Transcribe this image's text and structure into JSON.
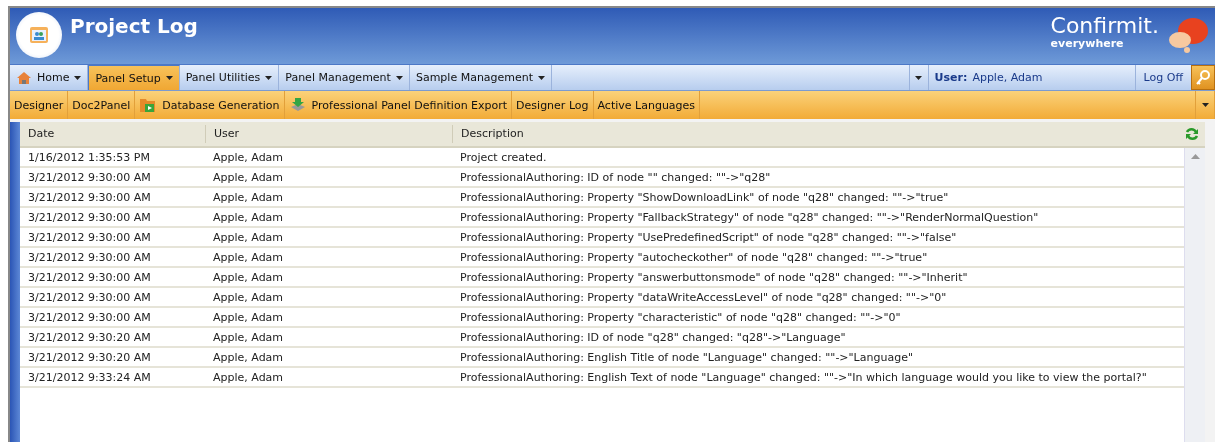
{
  "header": {
    "title": "Project Log",
    "brand": "Confirmit.",
    "tagline": "everywhere"
  },
  "menu": {
    "items": [
      {
        "label": "Home",
        "selected": false,
        "kind": "home"
      },
      {
        "label": "Panel Setup",
        "selected": true,
        "kind": "plain"
      },
      {
        "label": "Panel Utilities",
        "selected": false,
        "kind": "plain"
      },
      {
        "label": "Panel Management",
        "selected": false,
        "kind": "plain"
      },
      {
        "label": "Sample Management",
        "selected": false,
        "kind": "plain"
      }
    ],
    "user_label": "User:",
    "user_name": "Apple, Adam",
    "logoff": "Log Off"
  },
  "toolbar": {
    "items": [
      {
        "label": "Designer",
        "kind": "plain"
      },
      {
        "label": "Doc2Panel",
        "kind": "plain"
      },
      {
        "label": "Database Generation",
        "kind": "database"
      },
      {
        "label": "Professional Panel Definition Export",
        "kind": "export"
      },
      {
        "label": "Designer Log",
        "kind": "plain"
      },
      {
        "label": "Active Languages",
        "kind": "plain"
      }
    ]
  },
  "table": {
    "columns": [
      "Date",
      "User",
      "Description"
    ],
    "rows": [
      {
        "date": "1/16/2012 1:35:53 PM",
        "user": "Apple, Adam",
        "description": "Project created."
      },
      {
        "date": "3/21/2012 9:30:00 AM",
        "user": "Apple, Adam",
        "description": "ProfessionalAuthoring: ID of node \"\" changed: \"\"->\"q28\""
      },
      {
        "date": "3/21/2012 9:30:00 AM",
        "user": "Apple, Adam",
        "description": "ProfessionalAuthoring: Property \"ShowDownloadLink\" of node \"q28\" changed: \"\"->\"true\""
      },
      {
        "date": "3/21/2012 9:30:00 AM",
        "user": "Apple, Adam",
        "description": "ProfessionalAuthoring: Property \"FallbackStrategy\" of node \"q28\" changed: \"\"->\"RenderNormalQuestion\""
      },
      {
        "date": "3/21/2012 9:30:00 AM",
        "user": "Apple, Adam",
        "description": "ProfessionalAuthoring: Property \"UsePredefinedScript\" of node \"q28\" changed: \"\"->\"false\""
      },
      {
        "date": "3/21/2012 9:30:00 AM",
        "user": "Apple, Adam",
        "description": "ProfessionalAuthoring: Property \"autocheckother\" of node \"q28\" changed: \"\"->\"true\""
      },
      {
        "date": "3/21/2012 9:30:00 AM",
        "user": "Apple, Adam",
        "description": "ProfessionalAuthoring: Property \"answerbuttonsmode\" of node \"q28\" changed: \"\"->\"Inherit\""
      },
      {
        "date": "3/21/2012 9:30:00 AM",
        "user": "Apple, Adam",
        "description": "ProfessionalAuthoring: Property \"dataWriteAccessLevel\" of node \"q28\" changed: \"\"->\"0\""
      },
      {
        "date": "3/21/2012 9:30:00 AM",
        "user": "Apple, Adam",
        "description": "ProfessionalAuthoring: Property \"characteristic\" of node \"q28\" changed: \"\"->\"0\""
      },
      {
        "date": "3/21/2012 9:30:20 AM",
        "user": "Apple, Adam",
        "description": "ProfessionalAuthoring: ID of node \"q28\" changed: \"q28\"->\"Language\""
      },
      {
        "date": "3/21/2012 9:30:20 AM",
        "user": "Apple, Adam",
        "description": "ProfessionalAuthoring: English Title of node \"Language\" changed: \"\"->\"Language\""
      },
      {
        "date": "3/21/2012 9:33:24 AM",
        "user": "Apple, Adam",
        "description": "ProfessionalAuthoring: English Text of node \"Language\" changed: \"\"->\"In which language would you like to view the portal?\""
      }
    ]
  }
}
